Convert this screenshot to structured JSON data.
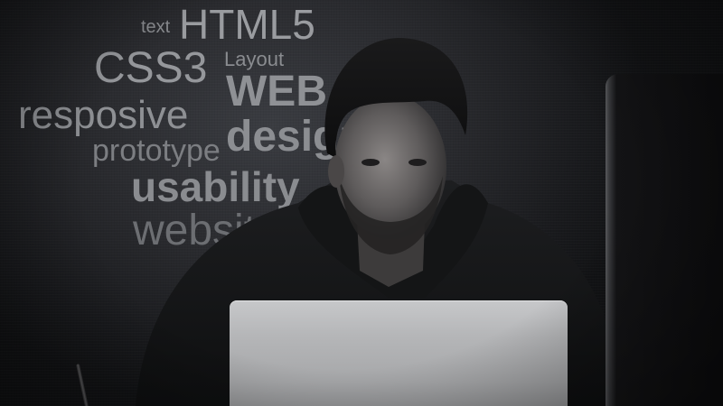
{
  "word_cloud": {
    "text": "text",
    "html5": "HTML5",
    "css3": "CSS3",
    "layout": "Layout",
    "web": "WEB",
    "resposive": "resposive",
    "design": "design",
    "prototype": "prototype",
    "usability": "usability",
    "website": "website"
  },
  "colors": {
    "background": "#1b1c1f",
    "word": "#8d8f93",
    "laptop": "#b5b6b8"
  }
}
